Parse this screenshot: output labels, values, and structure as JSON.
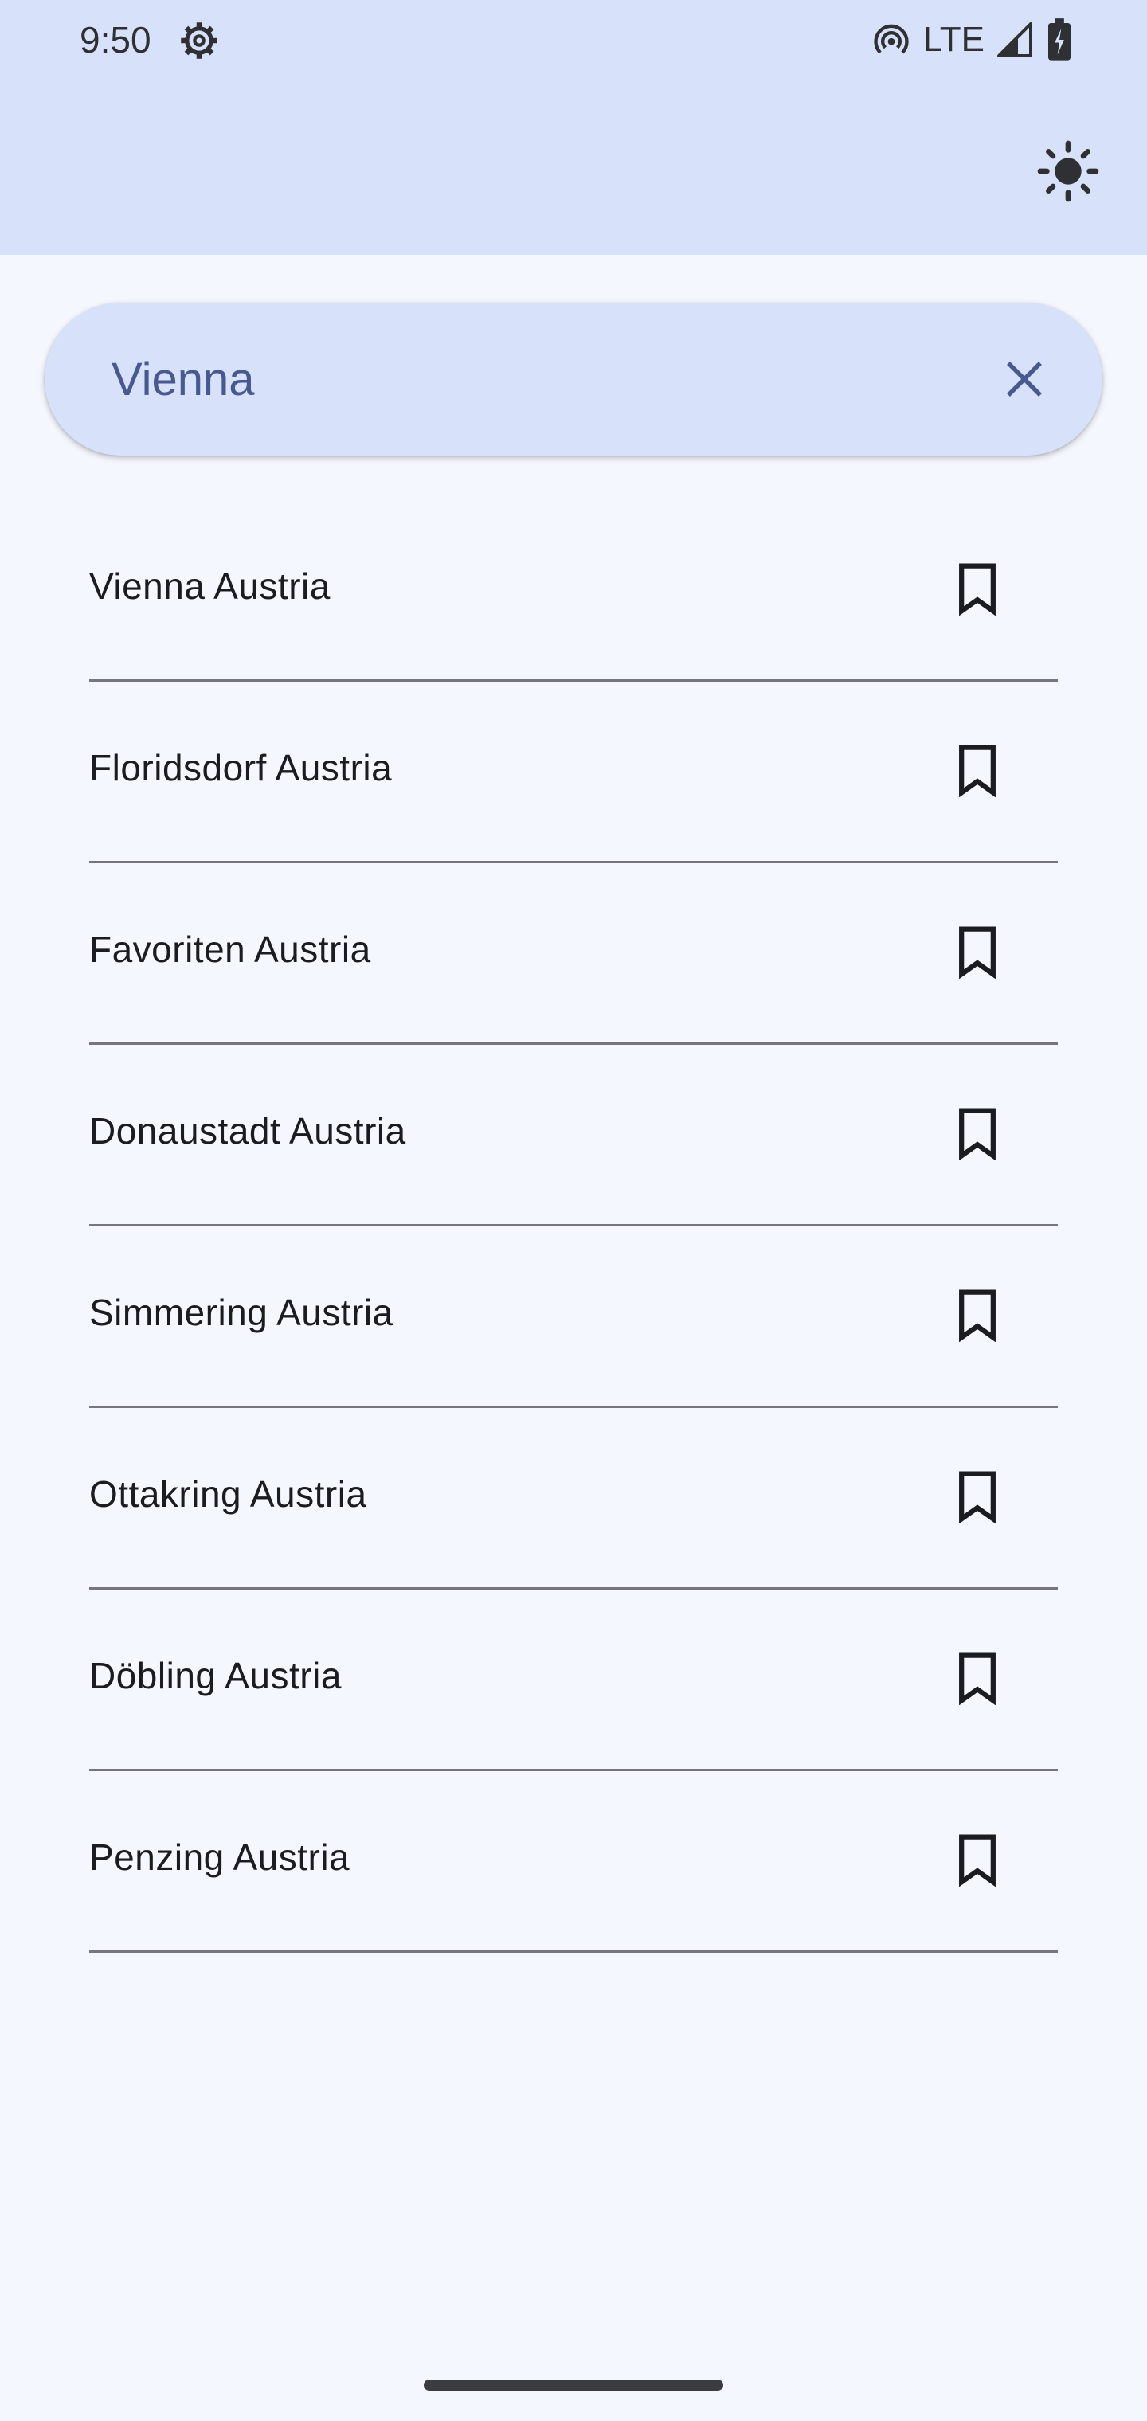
{
  "status_bar": {
    "time": "9:50",
    "network": "LTE",
    "icons": [
      "settings-gear-icon",
      "hotspot-icon",
      "signal-icon",
      "battery-icon"
    ]
  },
  "app_bar": {
    "theme_toggle_icon": "sun-icon"
  },
  "search": {
    "value": "Vienna",
    "clear_icon": "close-icon"
  },
  "results": [
    {
      "label": "Vienna Austria",
      "icon": "bookmark-icon"
    },
    {
      "label": "Floridsdorf Austria",
      "icon": "bookmark-icon"
    },
    {
      "label": "Favoriten Austria",
      "icon": "bookmark-icon"
    },
    {
      "label": "Donaustadt Austria",
      "icon": "bookmark-icon"
    },
    {
      "label": "Simmering Austria",
      "icon": "bookmark-icon"
    },
    {
      "label": "Ottakring Austria",
      "icon": "bookmark-icon"
    },
    {
      "label": "Döbling Austria",
      "icon": "bookmark-icon"
    },
    {
      "label": "Penzing Austria",
      "icon": "bookmark-icon"
    }
  ],
  "colors": {
    "header_background": "#d8e1fa",
    "page_background": "#f4f7fd",
    "search_text": "#47598f",
    "divider": "#75777d"
  }
}
